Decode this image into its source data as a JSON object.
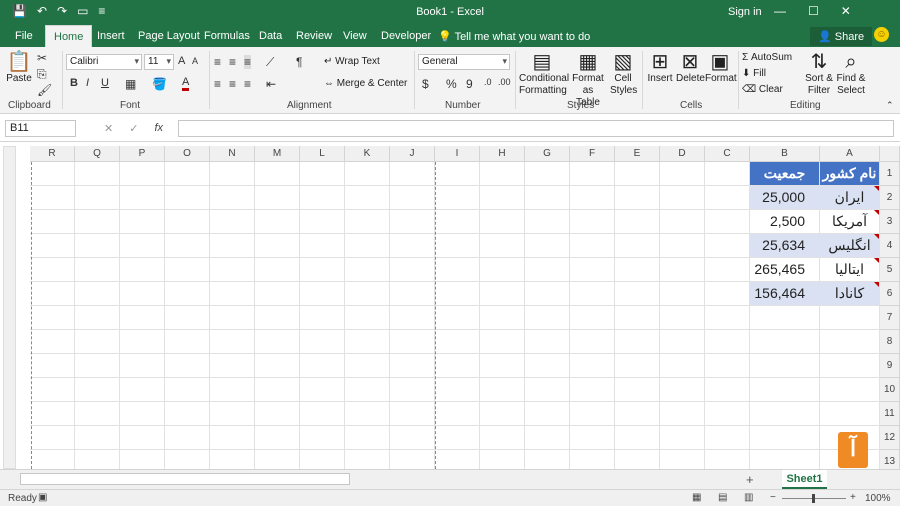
{
  "window": {
    "title": "Book1  -  Excel",
    "signin": "Sign in",
    "min": "—",
    "restore": "☐",
    "close": "✕"
  },
  "qat": {
    "save": "💾",
    "undo": "↶",
    "redo": "↷",
    "touch": "▭",
    "more": "≡"
  },
  "tabs": [
    "File",
    "Home",
    "Insert",
    "Page Layout",
    "Formulas",
    "Data",
    "Review",
    "View",
    "Developer"
  ],
  "tellme": "Tell me what you want to do",
  "share": "Share",
  "smile": "☺",
  "ribbon": {
    "groups": [
      "Clipboard",
      "Font",
      "Alignment",
      "Number",
      "Styles",
      "Cells",
      "Editing"
    ],
    "paste": "Paste",
    "font_name": "Calibri",
    "font_size": "11",
    "bold": "B",
    "italic": "I",
    "underline": "U",
    "grow": "A",
    "shrink": "A",
    "color_a": "A",
    "wrap": "Wrap Text",
    "merge": "Merge & Center",
    "number_format": "General",
    "currency": "$",
    "percent": "%",
    "comma": "9",
    "cond_fmt": "Conditional",
    "cond_fmt2": "Formatting",
    "fmt_table": "Format as",
    "fmt_table2": "Table",
    "cell_styles": "Cell",
    "cell_styles2": "Styles",
    "insert": "Insert",
    "delete": "Delete",
    "format": "Format",
    "autosum": "AutoSum",
    "fill": "Fill",
    "clear": "Clear",
    "sort": "Sort &",
    "sort2": "Filter",
    "find": "Find &",
    "find2": "Select"
  },
  "formula": {
    "name_box": "B11",
    "cancel": "✕",
    "enter": "✓",
    "fx": "fx",
    "value": ""
  },
  "columns": [
    "R",
    "Q",
    "P",
    "O",
    "N",
    "M",
    "L",
    "K",
    "J",
    "I",
    "H",
    "G",
    "F",
    "E",
    "D",
    "C",
    "B",
    "A"
  ],
  "rows": [
    "1",
    "2",
    "3",
    "4",
    "5",
    "6",
    "7",
    "8",
    "9",
    "10",
    "11",
    "12",
    "13"
  ],
  "table": {
    "header": {
      "a": "نام کشور",
      "b": "جمعیت"
    },
    "rows": [
      {
        "a": "ایران",
        "b": "25,000"
      },
      {
        "a": "آمریکا",
        "b": "2,500"
      },
      {
        "a": "انگلیس",
        "b": "25,634"
      },
      {
        "a": "ایتالیا",
        "b": "265,465"
      },
      {
        "a": "کانادا",
        "b": "156,464"
      }
    ]
  },
  "sheet_tab": "Sheet1",
  "add_sheet": "+",
  "status": {
    "ready": "Ready",
    "zoom": "100%",
    "minus": "−",
    "plus": "+"
  },
  "logo": "آ"
}
